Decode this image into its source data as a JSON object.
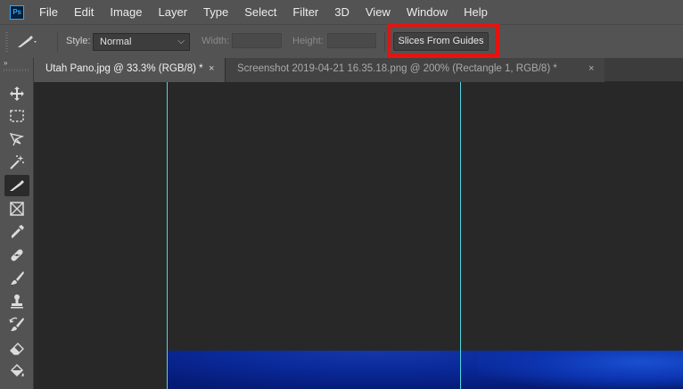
{
  "app": {
    "logo": "Ps"
  },
  "menu": [
    "File",
    "Edit",
    "Image",
    "Layer",
    "Type",
    "Select",
    "Filter",
    "3D",
    "View",
    "Window",
    "Help"
  ],
  "options": {
    "style_label": "Style:",
    "style_value": "Normal",
    "width_label": "Width:",
    "height_label": "Height:",
    "slices_button": "Slices From Guides"
  },
  "toolbar": {
    "collapse_glyph": "»",
    "tools": [
      "move-icon",
      "marquee-icon",
      "lasso-icon",
      "magic-wand-icon",
      "slice-icon",
      "frame-icon",
      "eyedropper-icon",
      "healing-brush-icon",
      "brush-icon",
      "clone-stamp-icon",
      "history-brush-icon",
      "eraser-icon",
      "paint-bucket-icon"
    ],
    "active_tool": "slice-icon"
  },
  "tabs": [
    {
      "label": "Utah Pano.jpg @ 33.3% (RGB/8) *",
      "close": "×",
      "active": true
    },
    {
      "label": "Screenshot 2019-04-21 16.35.18.png @ 200% (Rectangle 1, RGB/8) *",
      "close": "×",
      "active": false
    }
  ],
  "colors": {
    "highlight": "#e5130f",
    "guide": "#4fd6e0",
    "image_blue": "#0a2a9a"
  }
}
